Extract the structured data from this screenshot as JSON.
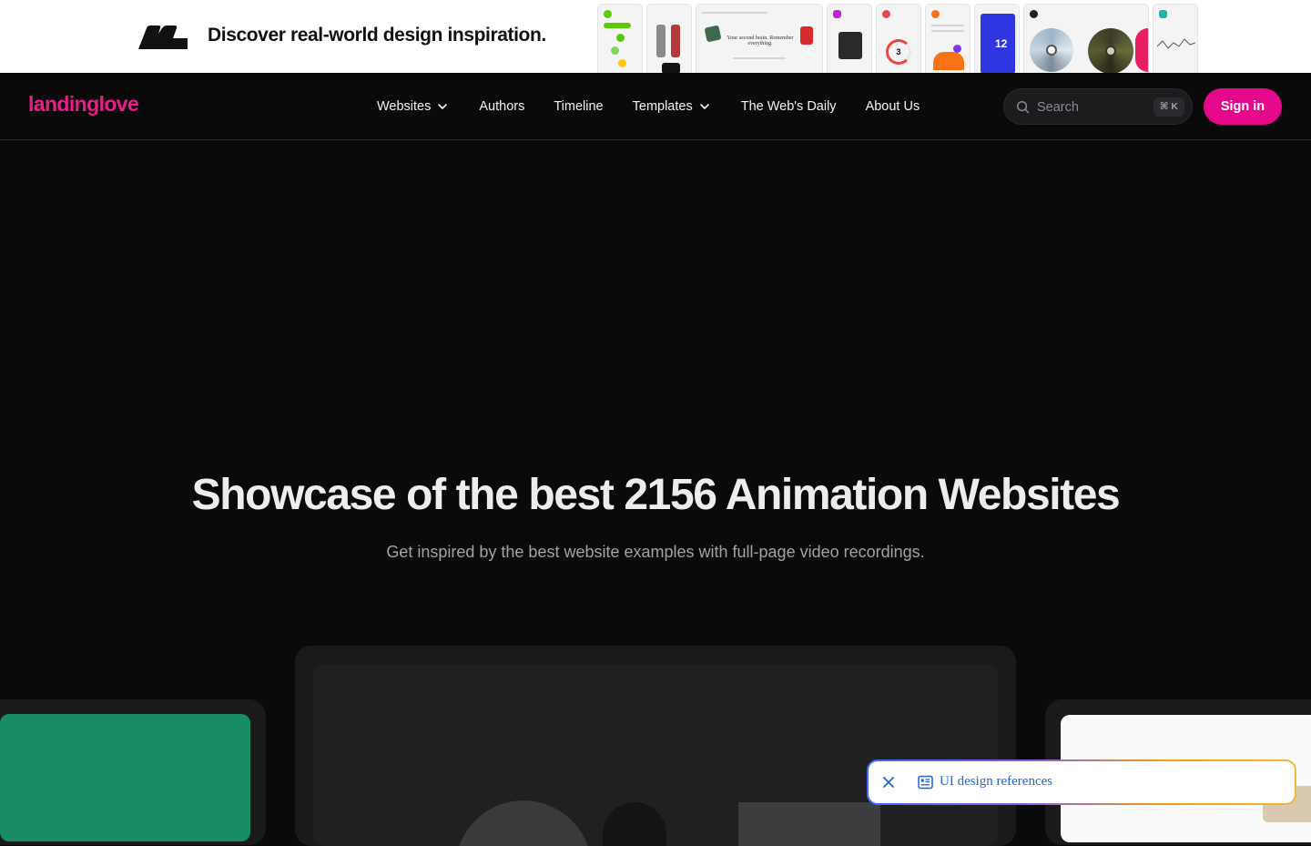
{
  "ad_banner": {
    "headline": "Discover real-world design inspiration.",
    "thumbnails": [
      "app-screen-1",
      "app-screen-2",
      "app-screen-3",
      "app-screen-4",
      "app-screen-5",
      "app-screen-6",
      "app-screen-7",
      "app-screen-8",
      "app-screen-9"
    ],
    "thumbnail_texts": {
      "t3": "Your second brain. Remember everything.",
      "t5": "3",
      "t7": "12"
    }
  },
  "navbar": {
    "brand": "landinglove",
    "links": [
      {
        "label": "Websites",
        "has_dropdown": true
      },
      {
        "label": "Authors",
        "has_dropdown": false
      },
      {
        "label": "Timeline",
        "has_dropdown": false
      },
      {
        "label": "Templates",
        "has_dropdown": true
      },
      {
        "label": "The Web's Daily",
        "has_dropdown": false
      },
      {
        "label": "About Us",
        "has_dropdown": false
      }
    ],
    "search": {
      "placeholder": "Search",
      "shortcut": "⌘ K"
    },
    "signin_label": "Sign in"
  },
  "hero": {
    "title": "Showcase of the best 2156 Animation Websites",
    "subtitle": "Get inspired by the best website examples with full-page video recordings."
  },
  "toast": {
    "label": "UI design references"
  },
  "colors": {
    "brand_pink": "#ec1c8a",
    "signin_bg": "#e5088a",
    "page_bg": "#0a0a0a",
    "card_green": "#178c65",
    "toast_text": "#1f63d6"
  },
  "icons": {
    "search": "search-icon",
    "chevron": "chevron-down-icon",
    "close": "close-icon",
    "toast": "document-list-icon"
  }
}
